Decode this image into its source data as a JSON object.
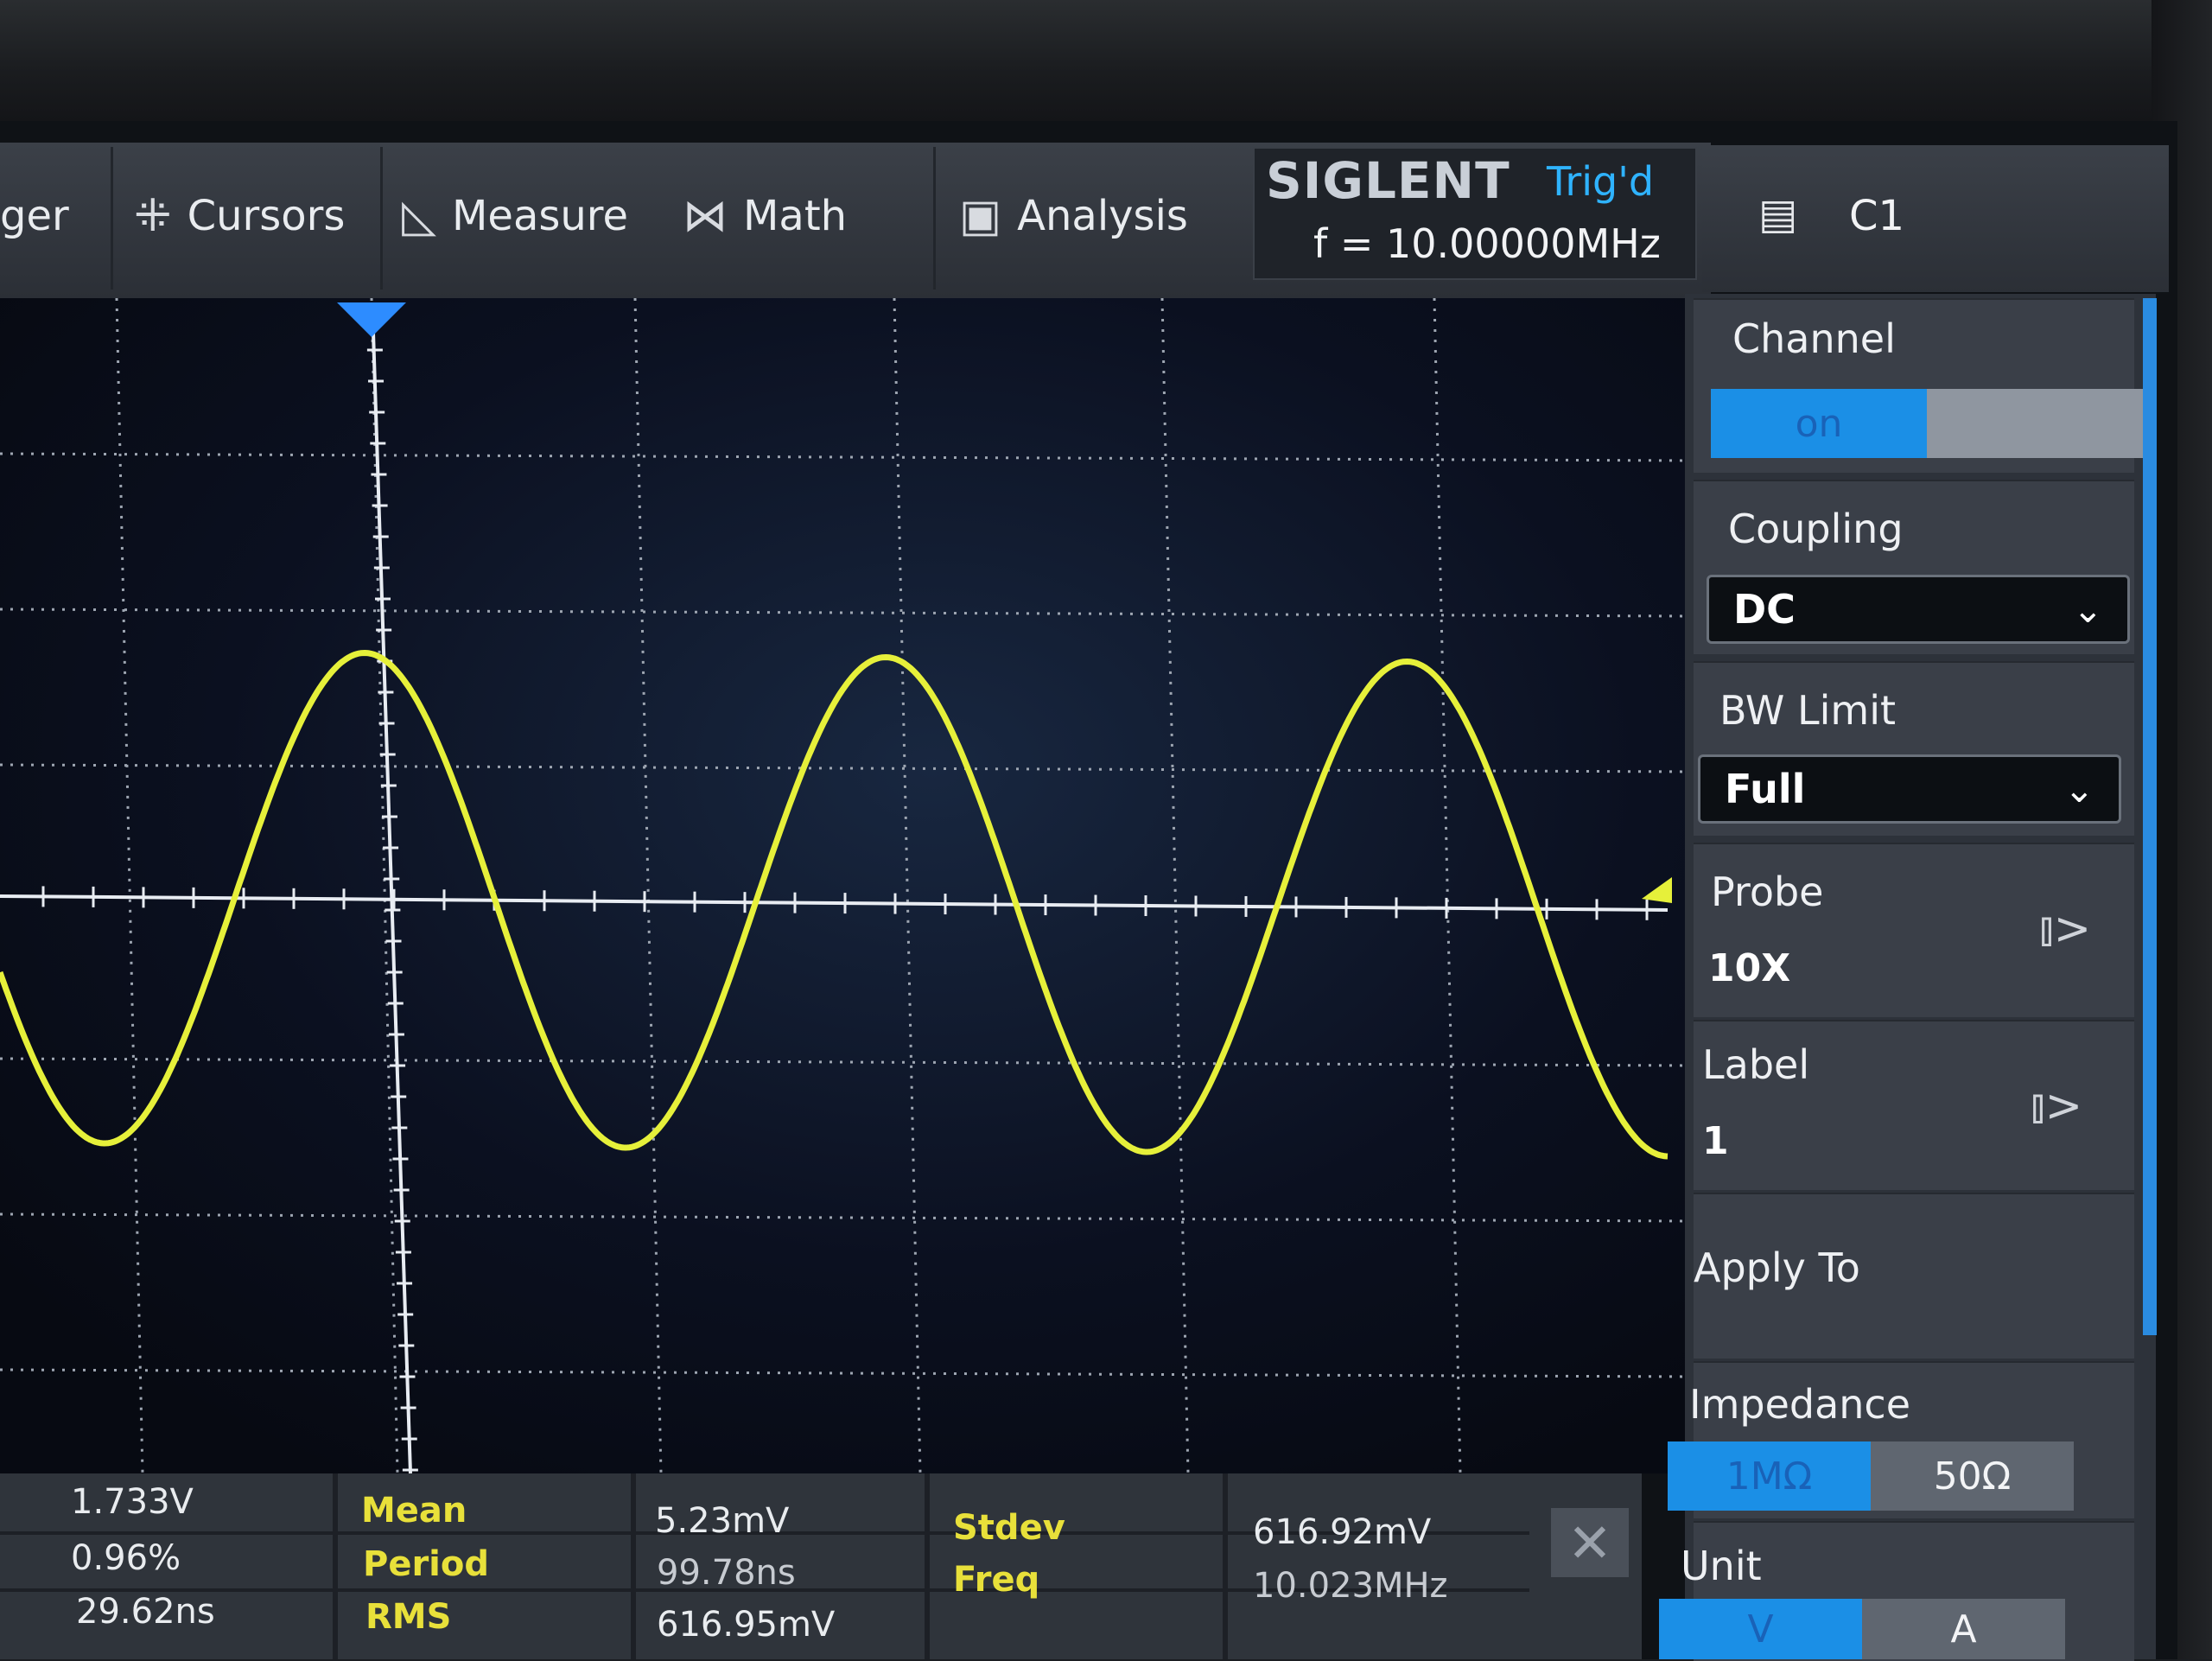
{
  "menu": {
    "trigger_partial": "ger",
    "cursors": "Cursors",
    "measure": "Measure",
    "math": "Math",
    "analysis": "Analysis"
  },
  "status": {
    "brand": "SIGLENT",
    "trigger_state": "Trig'd",
    "frequency": "f = 10.00000MHz",
    "channel": "C1"
  },
  "icons": {
    "cursors": "cursors-icon",
    "measure": "measure-icon",
    "math": "math-icon",
    "analysis": "analysis-icon",
    "clipboard": "clipboard-icon",
    "close": "close-icon"
  },
  "colors": {
    "waveform": "#e6f03a",
    "accent": "#1b8fe6",
    "trigger_marker": "#2d8cff"
  },
  "panel": {
    "channel": {
      "label": "Channel",
      "on": "on",
      "off": ""
    },
    "coupling": {
      "label": "Coupling",
      "value": "DC"
    },
    "bw_limit": {
      "label": "BW Limit",
      "value": "Full"
    },
    "probe": {
      "label": "Probe",
      "value": "10X"
    },
    "label": {
      "label": "Label",
      "value": "1"
    },
    "apply_to": {
      "label": "Apply To"
    },
    "impedance": {
      "label": "Impedance",
      "opt1": "1MΩ",
      "opt2": "50Ω"
    },
    "unit": {
      "label": "Unit",
      "opt1": "V",
      "opt2": "A"
    }
  },
  "measurements": {
    "col1": [
      "1.733V",
      "0.96%",
      "29.62ns"
    ],
    "names2": [
      "Mean",
      "Period",
      "RMS"
    ],
    "values2": [
      "5.23mV",
      "99.78ns",
      "616.95mV"
    ],
    "names3": [
      "Stdev",
      "Freq"
    ],
    "values3": [
      "616.92mV",
      "10.023MHz"
    ]
  },
  "chart_data": {
    "type": "line",
    "series": [
      {
        "shape": "sine",
        "frequency_mhz": 10.0,
        "cycles_visible": 3.2,
        "amplitude_divisions": 1.7
      }
    ],
    "grid": true
  }
}
